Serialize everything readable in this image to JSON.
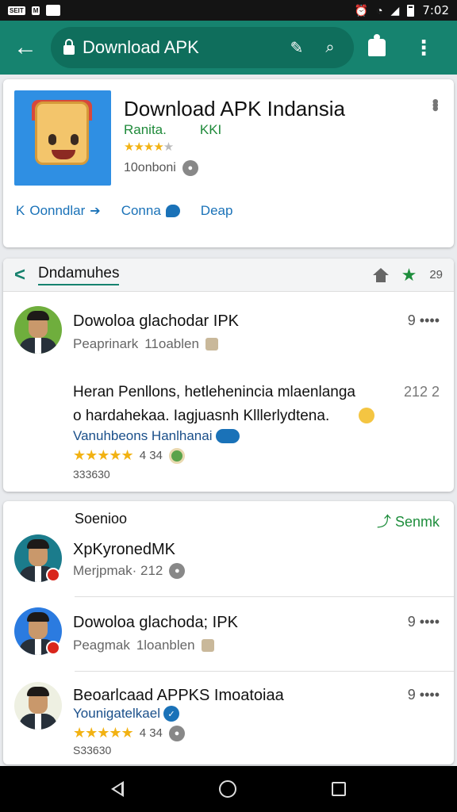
{
  "status_bar": {
    "left_badges": [
      "SEIT",
      "M"
    ],
    "time": "7:02",
    "icons": [
      "alarm-icon",
      "wifi-icon",
      "signal-icon",
      "battery-icon"
    ]
  },
  "app_bar": {
    "url": "Download APK",
    "icons": [
      "back-arrow-icon",
      "lock-icon",
      "translate-icon",
      "search-icon",
      "extension-icon",
      "overflow-menu-icon"
    ]
  },
  "app_card": {
    "title": "Download APK Indansia",
    "developer": "Ranita.",
    "developer_tag": "KKI",
    "rating_stars": 3.5,
    "downloads": "10onboni",
    "actions": [
      {
        "prefix": "K",
        "label": "Oonndlar"
      },
      {
        "prefix": "",
        "label": "Conna"
      },
      {
        "prefix": "",
        "label": "Deap"
      }
    ]
  },
  "reviews_card": {
    "header_title": "Dndamuhes",
    "header_count": "29",
    "review": {
      "author": "Dowoloa glachodar IPK",
      "meta_left": "Peaprinark",
      "meta_right": "11oablen",
      "rating_right": "9 ••••",
      "body_line1": "Heran Penllons, hetlehenincia mlaenlanga",
      "body_line1_num": "212 2",
      "body_line2": "o hardahekaa. Iagjuasnh Klllerlydtena.",
      "translate_link": "Vanuhbeons Hanlhanai",
      "stars": 5,
      "stars_value": "4 34",
      "footer_num": "333630"
    }
  },
  "similar_card": {
    "title": "Soenioo",
    "see_more": "Senmk",
    "items": [
      {
        "name": "XpKyronedMK",
        "meta": "Merjpmak· 212",
        "rating": ""
      },
      {
        "name": "Dowoloa glachoda; IPK",
        "meta": "Peagmak",
        "meta_right": "1loanblen",
        "rating": "9 ••••"
      },
      {
        "name": "Beoarlcaad APPKS Imoatoiaa",
        "meta": "Younigatelkael",
        "rating": "9 ••••",
        "stars": 5,
        "stars_value": "4 34",
        "footer_num": "S33630"
      }
    ]
  },
  "colors": {
    "app_bar": "#16836f",
    "url_pill": "#0f6e5c",
    "link_blue": "#1a72b8",
    "accent_green": "#1e8d3c",
    "star_yellow": "#f2b213"
  }
}
